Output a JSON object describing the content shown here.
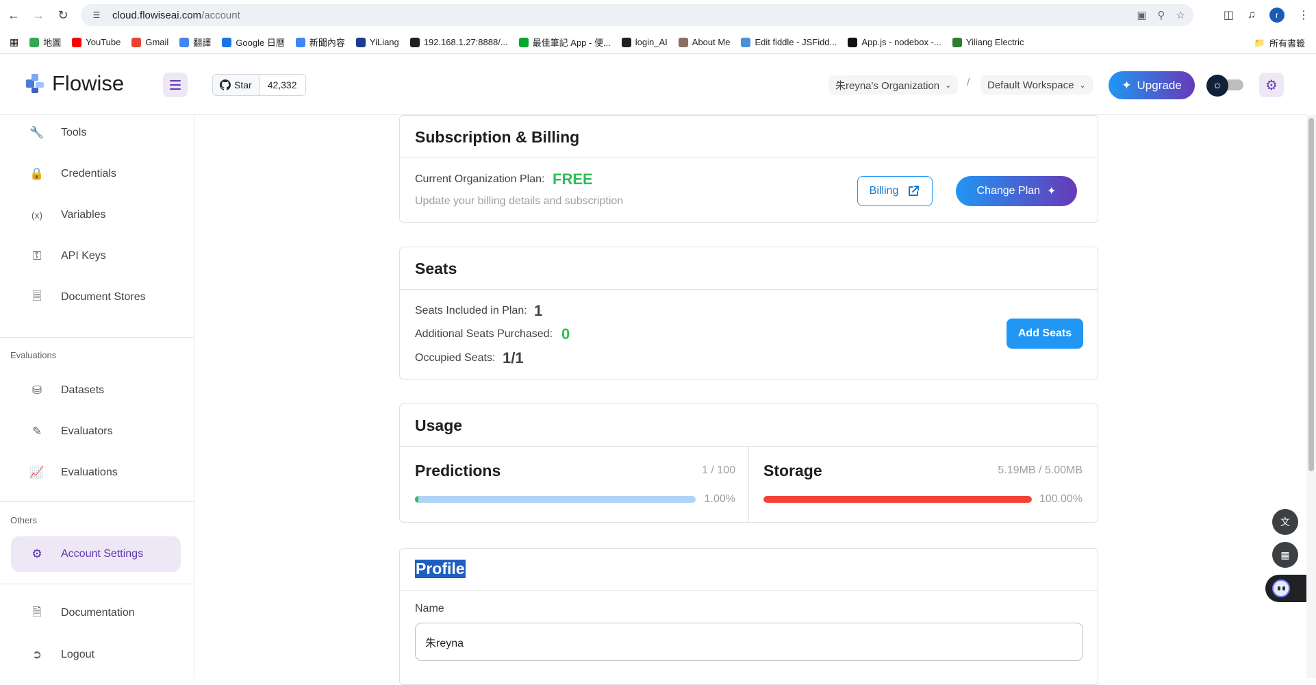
{
  "browser": {
    "url_host": "cloud.flowiseai.com",
    "url_path": "/account",
    "avatar_letter": "r",
    "bookmarks": [
      {
        "label": "地圖",
        "color": "#34a853"
      },
      {
        "label": "YouTube",
        "color": "#ff0000"
      },
      {
        "label": "Gmail",
        "color": "#ea4335"
      },
      {
        "label": "翻譯",
        "color": "#4285f4"
      },
      {
        "label": "Google 日曆",
        "color": "#1a73e8"
      },
      {
        "label": "新聞內容",
        "color": "#4285f4"
      },
      {
        "label": "YiLiang",
        "color": "#1a3c8f"
      },
      {
        "label": "192.168.1.27:8888/...",
        "color": "#202124"
      },
      {
        "label": "最佳筆記 App - 便...",
        "color": "#00a82d"
      },
      {
        "label": "login_AI",
        "color": "#202124"
      },
      {
        "label": "About Me",
        "color": "#8d6e63"
      },
      {
        "label": "Edit fiddle - JSFidd...",
        "color": "#4a90d9"
      },
      {
        "label": "App.js - nodebox -...",
        "color": "#111111"
      },
      {
        "label": "Yiliang Electric",
        "color": "#2e7d32"
      }
    ],
    "all_bookmarks": "所有書籤"
  },
  "header": {
    "brand": "Flowise",
    "github_star_label": "Star",
    "github_star_count": "42,332",
    "organization": "朱reyna's Organization",
    "separator": "/",
    "workspace": "Default Workspace",
    "upgrade_label": "Upgrade"
  },
  "sidebar": {
    "items_top": [
      {
        "label": "Tools",
        "icon": "wrench-icon"
      },
      {
        "label": "Credentials",
        "icon": "lock-icon"
      },
      {
        "label": "Variables",
        "icon": "variable-icon"
      },
      {
        "label": "API Keys",
        "icon": "key-icon"
      },
      {
        "label": "Document Stores",
        "icon": "files-icon"
      }
    ],
    "section_evaluations": "Evaluations",
    "items_eval": [
      {
        "label": "Datasets",
        "icon": "database-icon"
      },
      {
        "label": "Evaluators",
        "icon": "pen-icon"
      },
      {
        "label": "Evaluations",
        "icon": "chart-icon"
      }
    ],
    "section_others": "Others",
    "active_item": "Account Settings",
    "items_bottom": [
      {
        "label": "Documentation",
        "icon": "document-icon"
      },
      {
        "label": "Logout",
        "icon": "logout-icon"
      }
    ]
  },
  "billing": {
    "title": "Subscription & Billing",
    "plan_label": "Current Organization Plan:",
    "plan_value": "FREE",
    "description": "Update your billing details and subscription",
    "billing_button": "Billing",
    "change_plan_button": "Change Plan",
    "plan_color": "#2ebd59"
  },
  "seats": {
    "title": "Seats",
    "included_label": "Seats Included in Plan:",
    "included_value": "1",
    "additional_label": "Additional Seats Purchased:",
    "additional_value": "0",
    "occupied_label": "Occupied Seats:",
    "occupied_value": "1/1",
    "add_button": "Add Seats"
  },
  "usage": {
    "title": "Usage",
    "predictions": {
      "title": "Predictions",
      "count": "1 / 100",
      "percent_text": "1.00%",
      "fraction": 0.01,
      "color": "#2ebd59",
      "track": "#aed4f5"
    },
    "storage": {
      "title": "Storage",
      "count": "5.19MB / 5.00MB",
      "percent_text": "100.00%",
      "fraction": 1.0,
      "color": "#f44336"
    }
  },
  "profile": {
    "title": "Profile",
    "name_label": "Name",
    "name_value": "朱reyna"
  },
  "colors": {
    "accent_purple": "#673ab7",
    "accent_blue": "#2196f3"
  }
}
